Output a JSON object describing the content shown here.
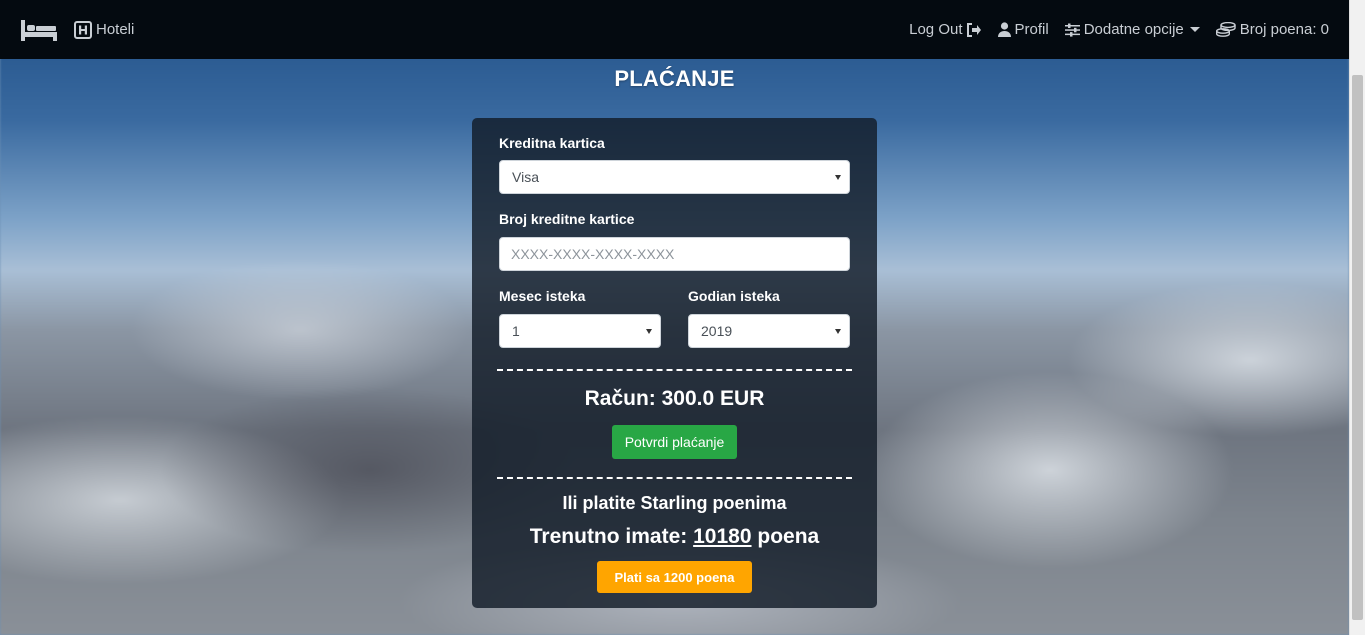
{
  "navbar": {
    "brand_icon": "bed-icon",
    "hotels": {
      "icon": "hotel-h-icon",
      "label": "Hoteli"
    },
    "logout": {
      "label": "Log Out",
      "icon": "sign-out-icon"
    },
    "profile": {
      "icon": "user-icon",
      "label": "Profil"
    },
    "more_options": {
      "icon": "sliders-icon",
      "label": "Dodatne opcije"
    },
    "points": {
      "icon": "coins-icon",
      "label": "Broj poena: 0"
    }
  },
  "page": {
    "title": "PLAĆANJE"
  },
  "form": {
    "card_type": {
      "label": "Kreditna kartica",
      "value": "Visa"
    },
    "card_number": {
      "label": "Broj kreditne kartice",
      "placeholder": "XXXX-XXXX-XXXX-XXXX",
      "value": ""
    },
    "expiry_month": {
      "label": "Mesec isteka",
      "value": "1"
    },
    "expiry_year": {
      "label": "Godian isteka",
      "value": "2019"
    }
  },
  "bill": {
    "label": "Račun: 300.0 EUR"
  },
  "confirm_button": "Potvrdi plaćanje",
  "points_section": {
    "heading": "Ili platite Starling poenima",
    "current_prefix": "Trenutno imate: ",
    "current_value": "10180",
    "current_suffix": " poena",
    "pay_button": "Plati sa 1200 poena"
  },
  "colors": {
    "navbar": "#040a10",
    "confirm": "#28a745",
    "pay_points": "#ffa500"
  }
}
